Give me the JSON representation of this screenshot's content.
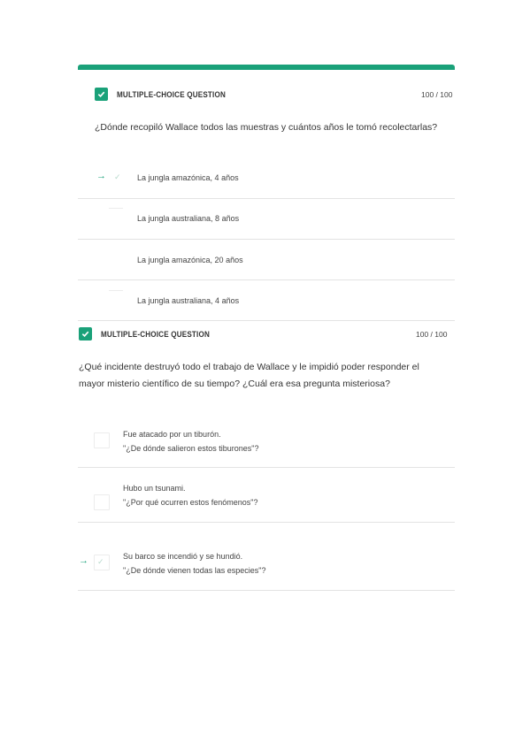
{
  "questions": [
    {
      "type": "MULTIPLE-CHOICE QUESTION",
      "score": "100 / 100",
      "question": "¿Dónde recopiló Wallace todos las muestras y cuántos años le tomó recolectarlas?",
      "options": [
        "La jungla amazónica, 4 años",
        "La jungla australiana, 8 años",
        "La jungla amazónica, 20 años",
        "La jungla australiana, 4 años"
      ]
    },
    {
      "type": "MULTIPLE-CHOICE QUESTION",
      "score": "100 / 100",
      "question_line1": "¿Qué incidente destruyó todo el trabajo de Wallace y le impidió poder responder el",
      "question_line2": "mayor misterio científico de su tiempo? ¿Cuál era esa pregunta misteriosa?",
      "options": [
        {
          "line1": "Fue atacado por un tiburón.",
          "line2": "\"¿De dónde salieron estos tiburones\"?"
        },
        {
          "line1": "Hubo un tsunami.",
          "line2": "\"¿Por qué ocurren estos fenómenos\"?"
        },
        {
          "line1": "Su barco se incendió y se hundió.",
          "line2": "\"¿De dónde vienen todas las especies\"?"
        }
      ]
    }
  ],
  "colors": {
    "accent": "#1aa179",
    "divider": "#e3e3e3"
  },
  "icons": {
    "selected": "arrow-right-icon",
    "correct": "check-icon",
    "header": "checkbox-checked-icon"
  }
}
